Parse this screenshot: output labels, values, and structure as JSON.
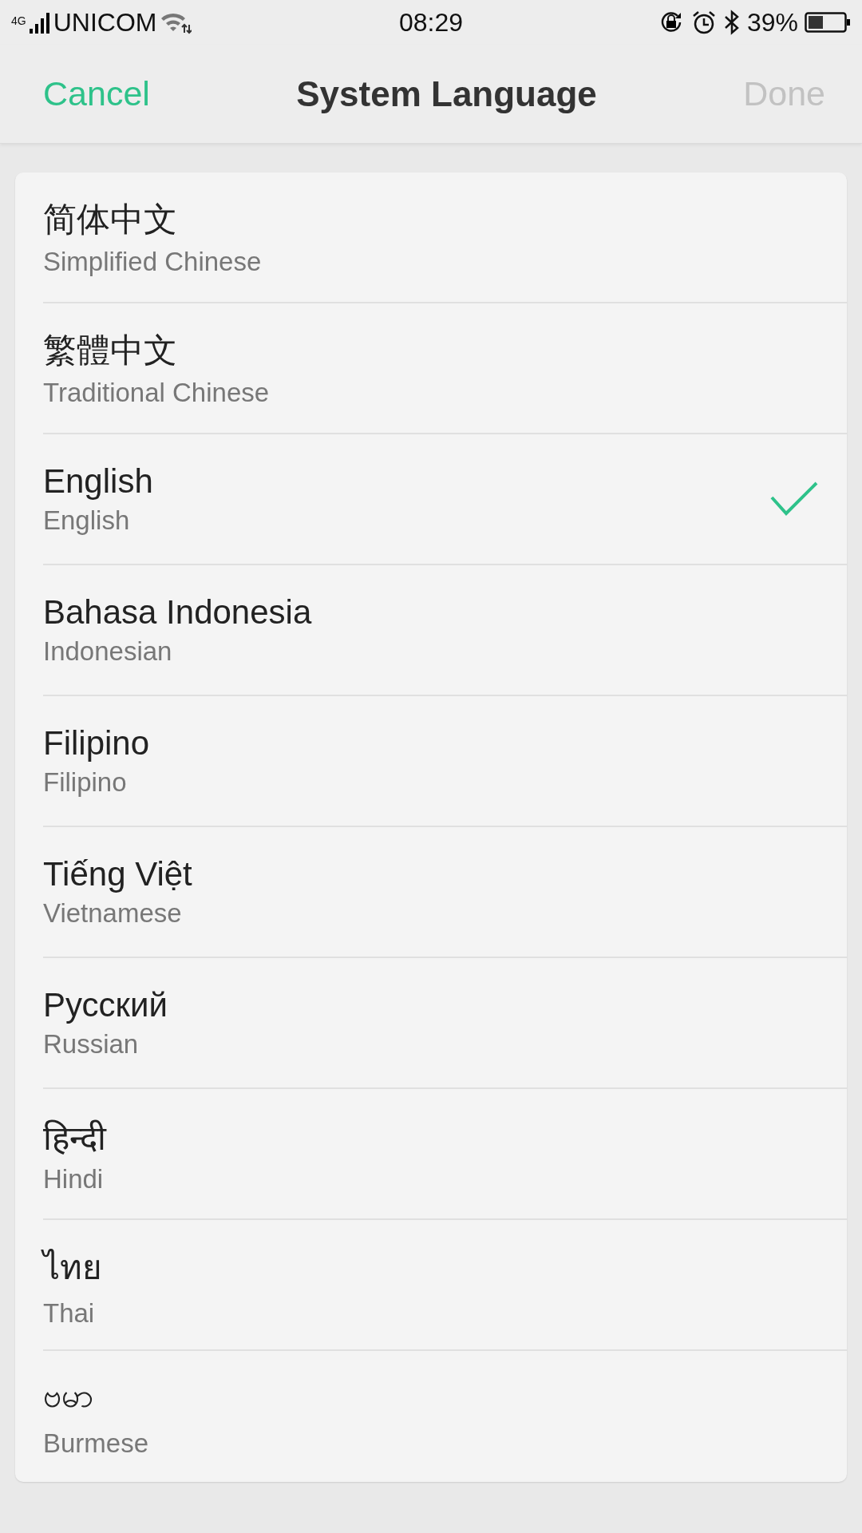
{
  "status_bar": {
    "network": "4G",
    "carrier": "UNICOM",
    "time": "08:29",
    "battery": "39%"
  },
  "nav": {
    "cancel": "Cancel",
    "title": "System Language",
    "done": "Done",
    "done_disabled": true
  },
  "languages": [
    {
      "name": "简体中文",
      "english": "Simplified Chinese",
      "selected": false
    },
    {
      "name": "繁體中文",
      "english": "Traditional Chinese",
      "selected": false
    },
    {
      "name": "English",
      "english": "English",
      "selected": true
    },
    {
      "name": "Bahasa Indonesia",
      "english": "Indonesian",
      "selected": false
    },
    {
      "name": "Filipino",
      "english": "Filipino",
      "selected": false
    },
    {
      "name": "Tiếng Việt",
      "english": "Vietnamese",
      "selected": false
    },
    {
      "name": "Русский",
      "english": "Russian",
      "selected": false
    },
    {
      "name": "हिन्दी",
      "english": "Hindi",
      "selected": false
    },
    {
      "name": "ไทย",
      "english": "Thai",
      "selected": false
    },
    {
      "name": "ဗမာ",
      "english": "Burmese",
      "selected": false
    }
  ]
}
